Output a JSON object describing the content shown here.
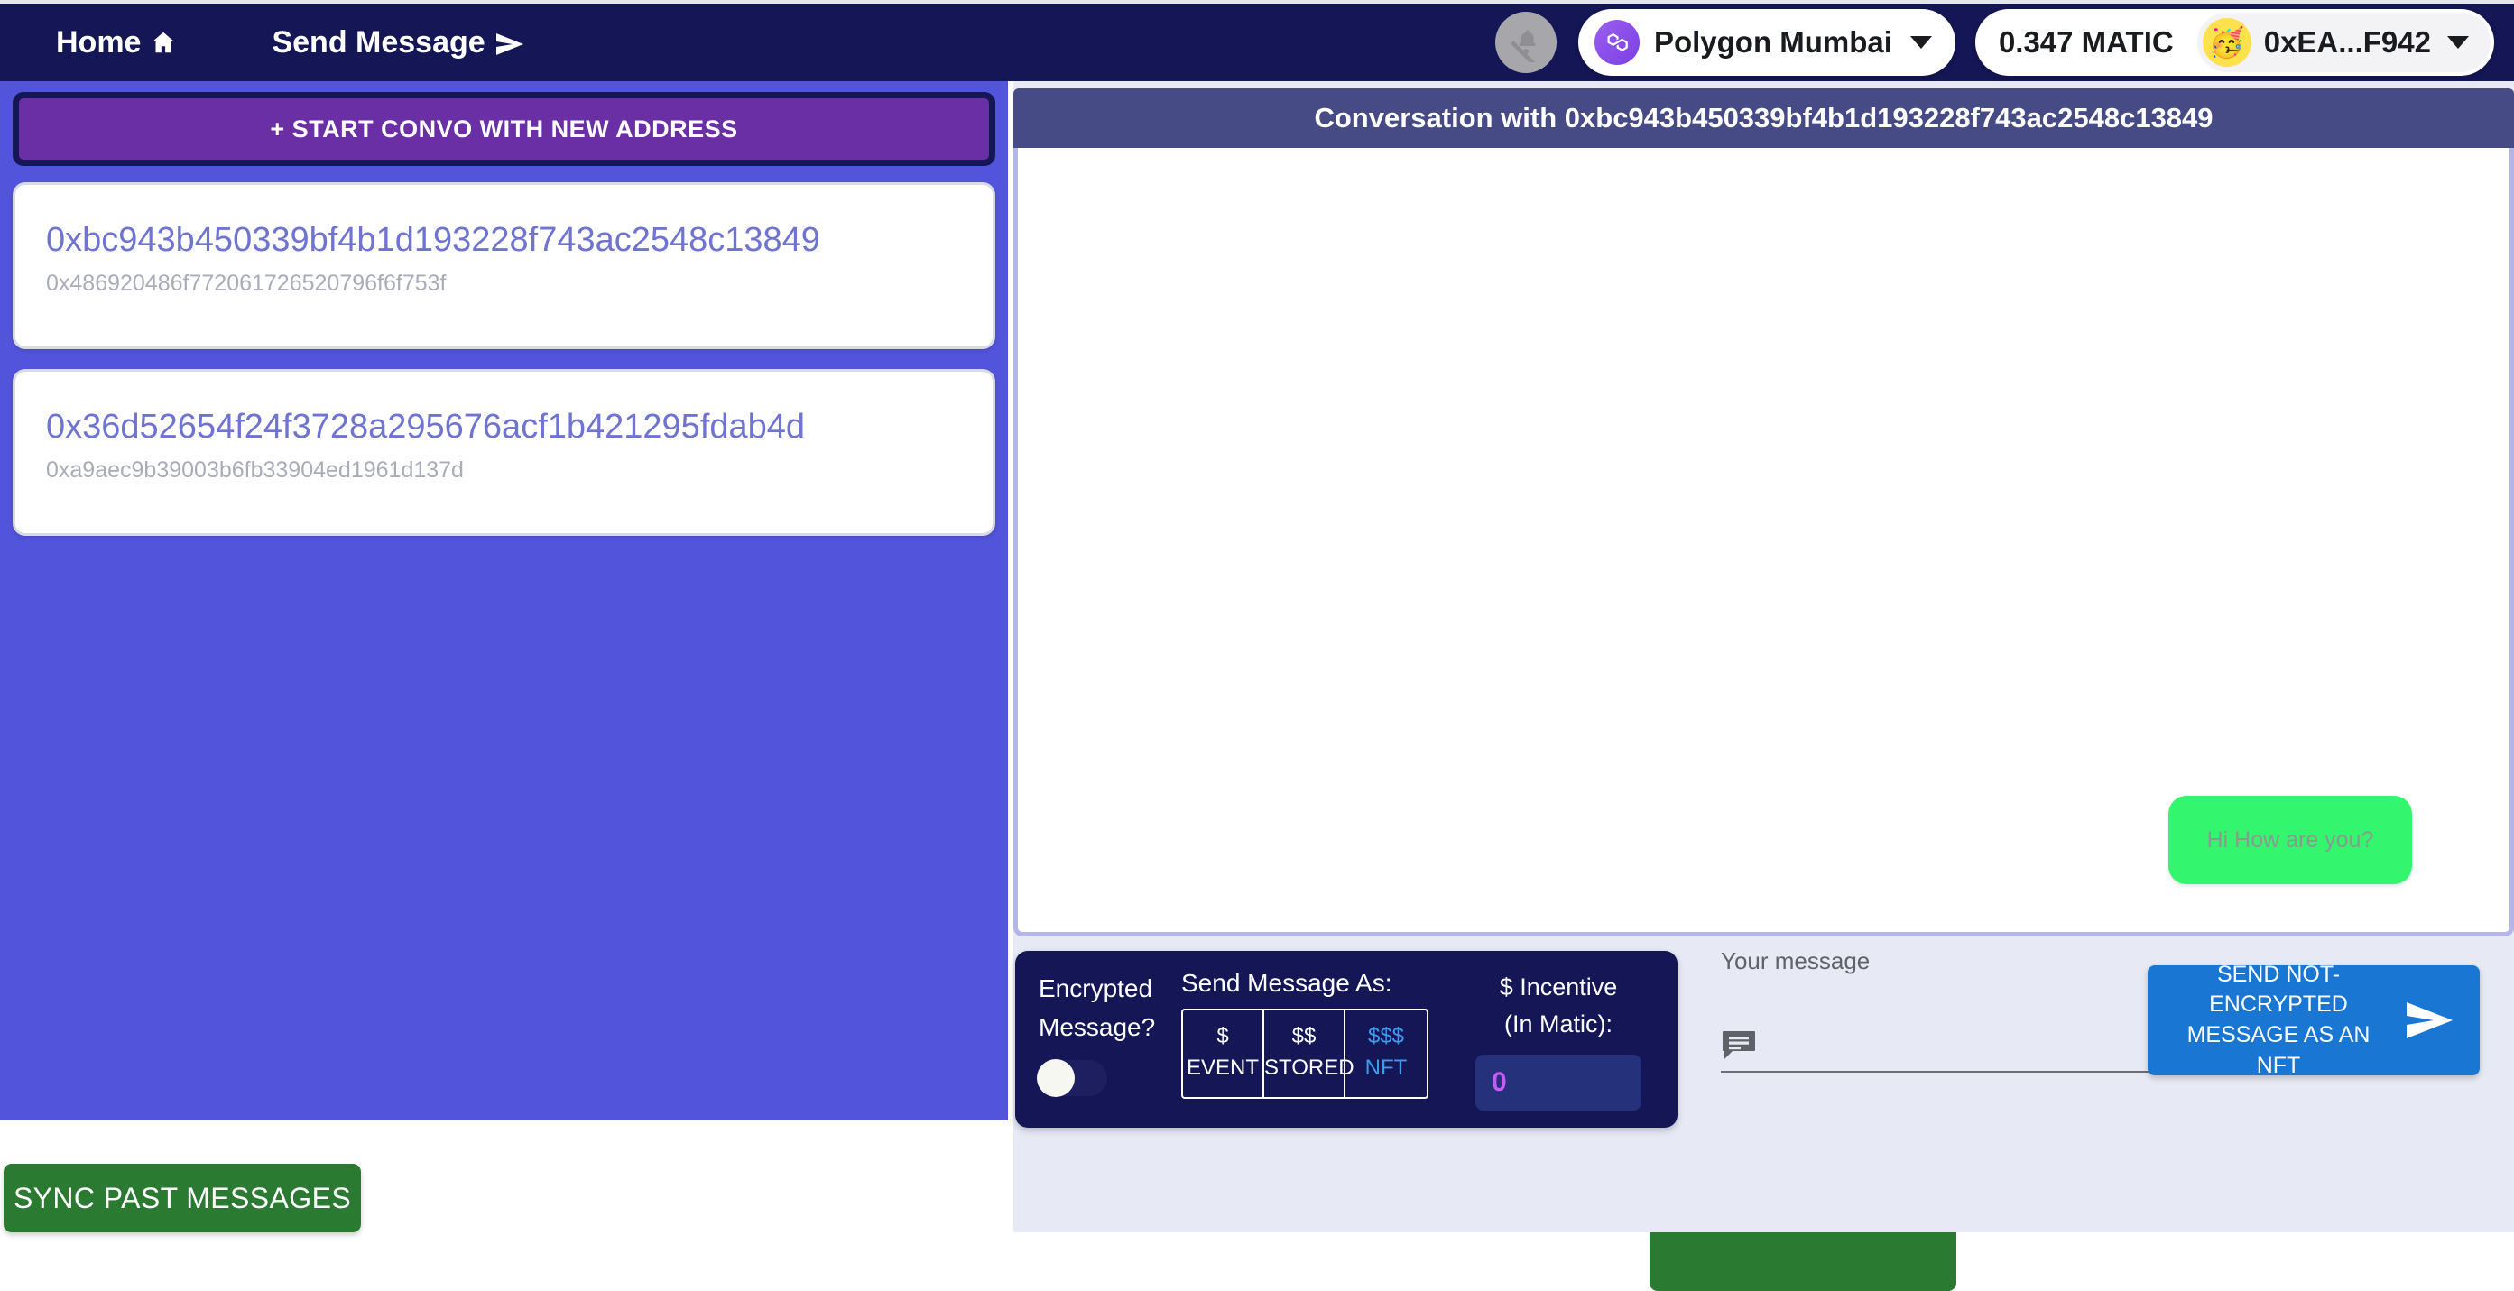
{
  "navbar": {
    "home_label": "Home",
    "home_icon": "home-icon",
    "send_label": "Send Message",
    "send_icon": "send-icon",
    "notifications_icon": "bell-off-icon",
    "chain_name": "Polygon Mumbai",
    "chain_icon": "polygon-logo-icon",
    "chain_chevron_icon": "chevron-down-icon",
    "balance": "0.347 MATIC",
    "account_address": "0xEA...F942",
    "account_avatar": "🥳",
    "account_chevron_icon": "chevron-down-icon"
  },
  "sidebar": {
    "new_convo_label": "+ START CONVO WITH NEW ADDRESS",
    "conversations": [
      {
        "address": "0xbc943b450339bf4b1d193228f743ac2548c13849",
        "subtitle": "0x486920486f772061726520796f6f753f"
      },
      {
        "address": "0x36d52654f24f3728a295676acf1b421295fdab4d",
        "subtitle": "0xa9aec9b39003b6fb33904ed1961d137d"
      }
    ],
    "sync_label": "SYNC PAST MESSAGES"
  },
  "chat": {
    "header_title": "Conversation with 0xbc943b450339bf4b1d193228f743ac2548c13849",
    "messages": [
      {
        "text": "Hi How are you?",
        "direction": "outgoing"
      }
    ]
  },
  "controls": {
    "encrypted_label_line1": "Encrypted",
    "encrypted_label_line2": "Message?",
    "encrypted_enabled": false,
    "send_as_title": "Send Message As:",
    "send_as_options": [
      {
        "price": "$",
        "name": "EVENT",
        "selected": false
      },
      {
        "price": "$$",
        "name": "STORED",
        "selected": false
      },
      {
        "price": "$$$",
        "name": "NFT",
        "selected": true
      }
    ],
    "incentive_label_line1": "$ Incentive",
    "incentive_label_line2": "(In Matic):",
    "incentive_value": "0",
    "message_label": "Your message",
    "message_value": "",
    "message_placeholder": "",
    "message_icon": "chat-bubble-icon",
    "send_button_label": "SEND NOT-ENCRYPTED MESSAGE AS AN NFT",
    "send_button_icon": "send-icon"
  },
  "colors": {
    "navbar_bg": "#141655",
    "sidebar_bg": "#5254dc",
    "new_convo_bg": "#6b2fa5",
    "chat_header_bg": "#474b85",
    "bubble_out_bg": "#34f56e",
    "panel_bg": "#141655",
    "send_button_bg": "#1976d2",
    "sync_button_bg": "#2a7a32",
    "accent_nft": "#3d9bf0",
    "incentive_text": "#c85bf5"
  }
}
